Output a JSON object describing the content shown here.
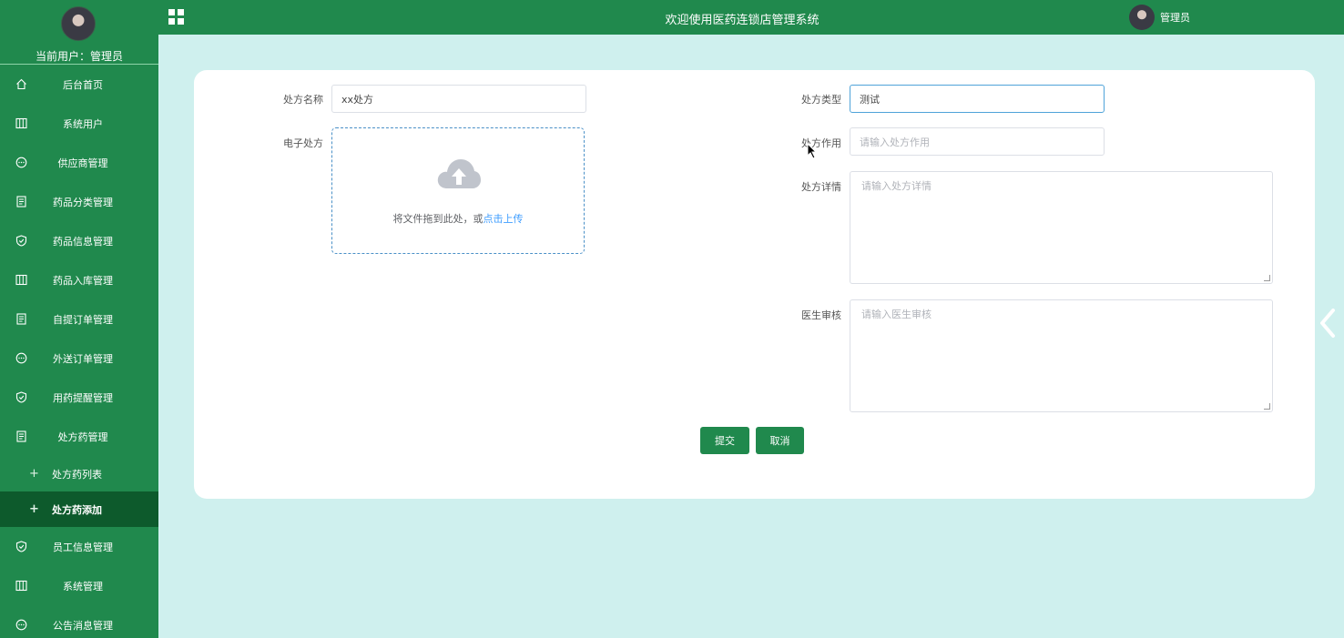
{
  "sidebar": {
    "current_user": "当前用户：管理员",
    "items": [
      {
        "label": "后台首页",
        "icon": "home-icon"
      },
      {
        "label": "系统用户",
        "icon": "columns-icon"
      },
      {
        "label": "供应商管理",
        "icon": "chat-icon"
      },
      {
        "label": "药品分类管理",
        "icon": "document-icon"
      },
      {
        "label": "药品信息管理",
        "icon": "shield-icon"
      },
      {
        "label": "药品入库管理",
        "icon": "columns-icon"
      },
      {
        "label": "自提订单管理",
        "icon": "document-icon"
      },
      {
        "label": "外送订单管理",
        "icon": "chat-icon"
      },
      {
        "label": "用药提醒管理",
        "icon": "shield-icon"
      },
      {
        "label": "处方药管理",
        "icon": "document-icon"
      }
    ],
    "sub_items": [
      {
        "label": "处方药列表"
      },
      {
        "label": "处方药添加"
      }
    ],
    "items_after": [
      {
        "label": "员工信息管理",
        "icon": "shield-icon"
      },
      {
        "label": "系统管理",
        "icon": "columns-icon"
      },
      {
        "label": "公告消息管理",
        "icon": "chat-icon"
      }
    ]
  },
  "topbar": {
    "title": "欢迎使用医药连锁店管理系统",
    "user": "管理员"
  },
  "form": {
    "name_label": "处方名称",
    "name_value": "xx处方",
    "type_label": "处方类型",
    "type_value": "测试",
    "file_label": "电子处方",
    "upload_text": "将文件拖到此处，或",
    "upload_link": "点击上传",
    "effect_label": "处方作用",
    "effect_placeholder": "请输入处方作用",
    "detail_label": "处方详情",
    "detail_placeholder": "请输入处方详情",
    "review_label": "医生审核",
    "review_placeholder": "请输入医生审核",
    "submit_label": "提交",
    "cancel_label": "取消"
  },
  "colors": {
    "brand": "#20894d",
    "active_menu": "#0d5a2c",
    "background": "#cff0ee"
  }
}
